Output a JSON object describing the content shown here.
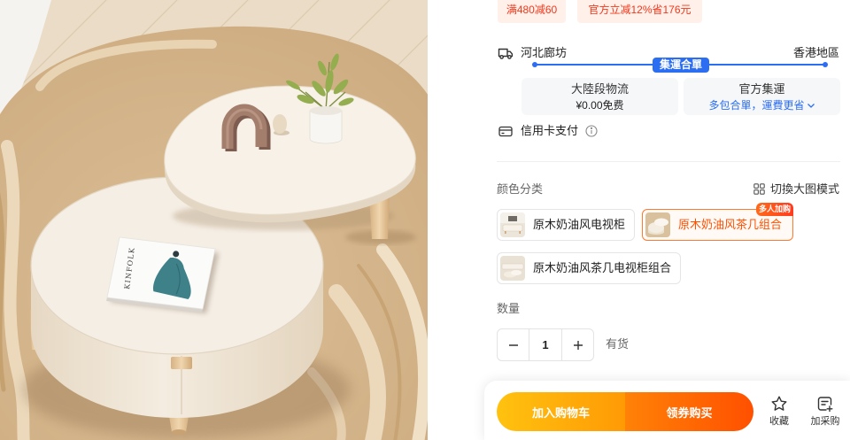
{
  "product_image": {
    "book_cover_text": "KINFOLK"
  },
  "coupons": [
    {
      "label": "满480减60"
    },
    {
      "label": "官方立减12%省176元"
    }
  ],
  "shipping": {
    "origin": "河北廊坊",
    "destination": "香港地區",
    "route_badge": "集運合單",
    "segments": [
      {
        "title": "大陸段物流",
        "detail": "¥0.00免费"
      },
      {
        "title": "官方集運",
        "detail": "多包合單，運費更省"
      }
    ]
  },
  "payment": {
    "label": "信用卡支付"
  },
  "sku": {
    "label": "颜色分类",
    "view_toggle": "切換大图模式",
    "options": [
      {
        "label": "原木奶油风电视柜",
        "selected": false
      },
      {
        "label": "原木奶油风茶几组合",
        "selected": true,
        "badge": "多人加购"
      },
      {
        "label": "原木奶油风茶几电视柜组合",
        "selected": false
      }
    ]
  },
  "quantity": {
    "label": "数量",
    "value": "1",
    "stock_status": "有货"
  },
  "actions": {
    "add_to_cart": "加入购物车",
    "buy_with_coupon": "领券购买",
    "favorite": "收藏",
    "add_to_purchase": "加采购"
  },
  "icons": {
    "shipping": "truck-icon",
    "payment": "credit-card-icon",
    "payment_info": "info-icon",
    "view_toggle": "grid-icon",
    "segment_more": "chevron-down-icon",
    "quantity_decrease": "minus-icon",
    "quantity_increase": "plus-icon",
    "favorite": "star-icon",
    "add_to_purchase": "add-purchase-icon"
  },
  "colors": {
    "coupon_text": "#f2381b",
    "coupon_bg": "#fff0ea",
    "link_blue": "#2b6ef2",
    "selected_orange": "#ff5000",
    "badge_red": "#ff3b1f",
    "cart_gradient_start": "#ffc20f",
    "cart_gradient_end": "#ff9a05",
    "buy_gradient_start": "#ff8207",
    "buy_gradient_end": "#ff5000"
  }
}
